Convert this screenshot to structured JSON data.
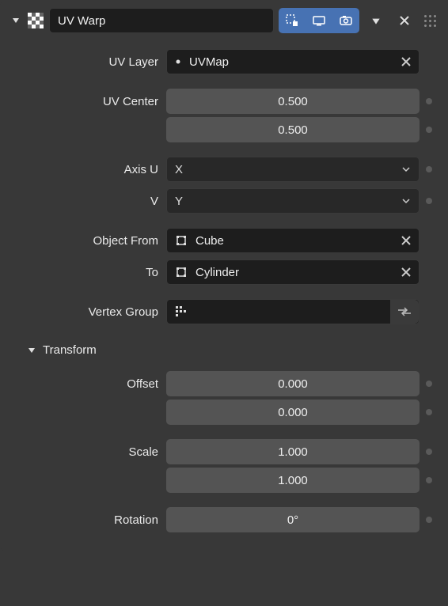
{
  "header": {
    "title": "UV Warp"
  },
  "sections": {
    "transform_label": "Transform"
  },
  "labels": {
    "uv_layer": "UV Layer",
    "uv_center": "UV Center",
    "axis_u": "Axis U",
    "axis_v": "V",
    "object_from": "Object From",
    "object_to": "To",
    "vertex_group": "Vertex Group",
    "offset": "Offset",
    "scale": "Scale",
    "rotation": "Rotation"
  },
  "values": {
    "uv_layer": "UVMap",
    "uv_center_x": "0.500",
    "uv_center_y": "0.500",
    "axis_u": "X",
    "axis_v": "Y",
    "object_from": "Cube",
    "object_to": "Cylinder",
    "vertex_group": "",
    "offset_x": "0.000",
    "offset_y": "0.000",
    "scale_x": "1.000",
    "scale_y": "1.000",
    "rotation": "0°"
  }
}
